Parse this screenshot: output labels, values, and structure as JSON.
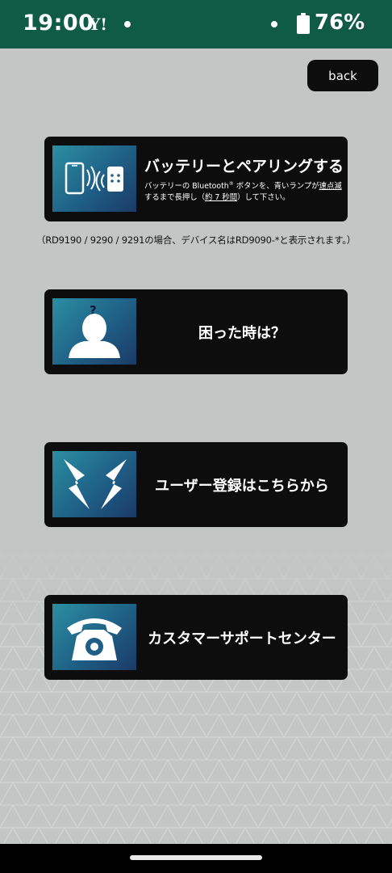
{
  "status_bar": {
    "time": "19:00",
    "yahoo_mark": "Y!",
    "battery_percent": "76%",
    "icons": [
      "yahoo-icon",
      "notification-dot-icon",
      "battery-icon"
    ]
  },
  "header": {
    "back_label": "back"
  },
  "menu": {
    "pairing": {
      "title": "バッテリーとペアリングする",
      "desc_line1_prefix": "バッテリーの Bluetooth",
      "desc_line1_reg": "®",
      "desc_line1_mid": " ボタンを、青いランプが",
      "desc_line1_underlined": "速点滅",
      "desc_line2_prefix": "するまで長押し（",
      "desc_line2_underlined": "約 7 秒間",
      "desc_line2_suffix": "）して下さい。",
      "icon": "phone-bluetooth-battery-icon"
    },
    "note": "（RD9190 / 9290 / 9291の場合、デバイス名はRD9090-*と表示されます。）",
    "trouble": {
      "title": "困った時は？",
      "icon": "person-question-icon"
    },
    "register": {
      "title": "ユーザー登録はこちらから",
      "icon": "brand-logo-icon"
    },
    "support": {
      "title": "カスタマーサポートセンター",
      "icon": "telephone-icon"
    }
  },
  "colors": {
    "status_bar": "#0f5b46",
    "background": "#c4c6c5",
    "card": "#0d0d0d",
    "thumb_gradient_start": "#2b8fa1",
    "thumb_gradient_end": "#1a3a66"
  }
}
